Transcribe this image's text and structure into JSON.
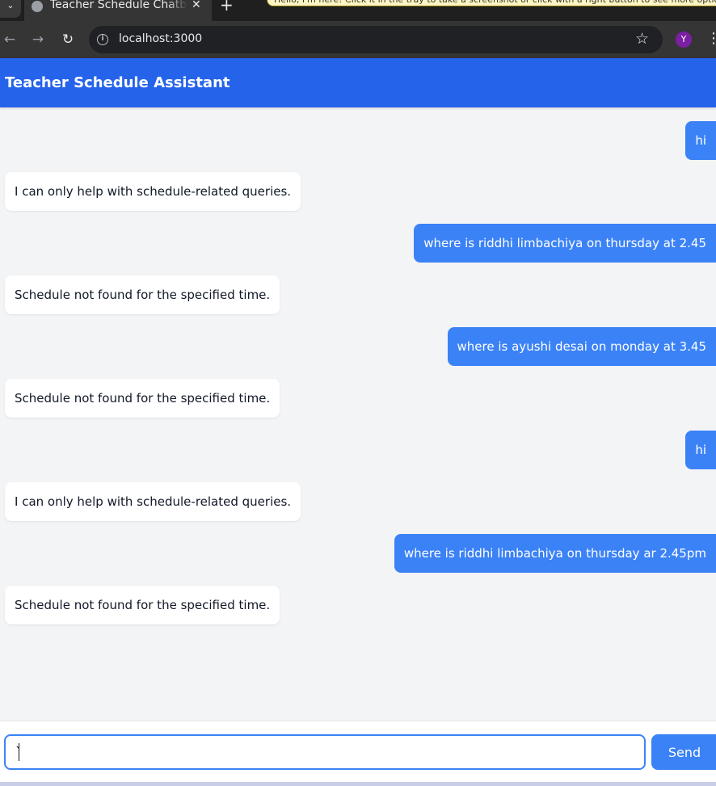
{
  "browser": {
    "tab_title": "Teacher Schedule Chatbot",
    "tab_close": "✕",
    "new_tab": "+",
    "tooltip": "Hello, I'm here! Click it in the tray to take a screenshot or click with a right button to see more options",
    "url": "localhost:3000",
    "profile_initial": "Y"
  },
  "app": {
    "title": "Teacher Schedule Assistant"
  },
  "messages": [
    {
      "role": "user",
      "text": "hi"
    },
    {
      "role": "bot",
      "text": "I can only help with schedule-related queries."
    },
    {
      "role": "user",
      "text": "where is riddhi limbachiya on thursday at 2.45"
    },
    {
      "role": "bot",
      "text": "Schedule not found for the specified time."
    },
    {
      "role": "user",
      "text": "where is ayushi desai on monday at 3.45"
    },
    {
      "role": "bot",
      "text": "Schedule not found for the specified time."
    },
    {
      "role": "user",
      "text": "hi"
    },
    {
      "role": "bot",
      "text": "I can only help with schedule-related queries."
    },
    {
      "role": "user",
      "text": "where is riddhi limbachiya on thursday ar 2.45pm"
    },
    {
      "role": "bot",
      "text": "Schedule not found for the specified time."
    }
  ],
  "composer": {
    "value": "`",
    "send_label": "Send"
  },
  "colors": {
    "header": "#2563eb",
    "user_bubble": "#3b82f6",
    "bot_bubble": "#ffffff",
    "background": "#f3f4f6"
  }
}
